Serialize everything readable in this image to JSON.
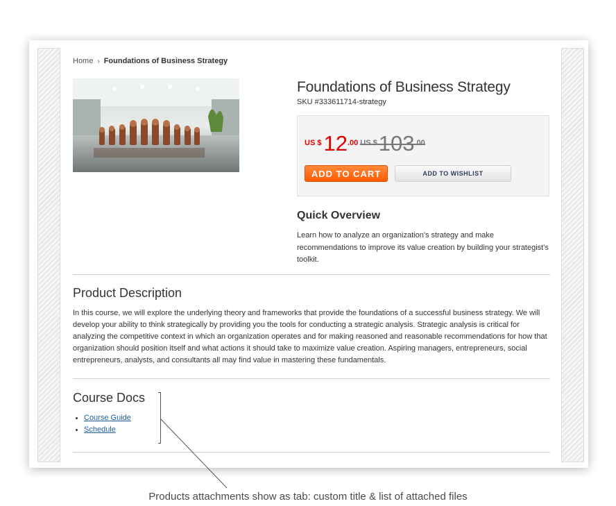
{
  "breadcrumb": {
    "home": "Home",
    "separator": "›",
    "current": "Foundations of Business Strategy"
  },
  "product": {
    "title": "Foundations of Business Strategy",
    "sku": "SKU #333611714-strategy",
    "image_icon": "chess-pieces-image"
  },
  "price": {
    "currency": "US $",
    "new_main": "12",
    "new_cents": ".00",
    "old_currency": "US $",
    "old_main": "103",
    "old_cents": ".00"
  },
  "buttons": {
    "add_to_cart": "ADD TO CART",
    "add_to_wishlist": "ADD TO WISHLIST"
  },
  "overview": {
    "heading": "Quick Overview",
    "text": "Learn how to analyze an organization's strategy and make recommendations to improve its value creation by building your strategist's toolkit."
  },
  "description": {
    "heading": "Product Description",
    "text": "In this course, we will explore the underlying theory and frameworks that provide the foundations of a successful business strategy. We will develop your ability to think strategically by providing you the tools for conducting a strategic analysis. Strategic analysis is critical for analyzing the competitive context in which an organization operates and for making reasoned and reasonable recommendations for how that organization should position itself and what actions it should take to maximize value creation. Aspiring managers, entrepreneurs, social entrepreneurs, analysts, and consultants all may find value in mastering these fundamentals."
  },
  "docs": {
    "heading": "Course Docs",
    "items": [
      {
        "label": "Course Guide"
      },
      {
        "label": "Schedule"
      }
    ]
  },
  "caption": "Products attachments show as tab: custom title & list of attached files",
  "colors": {
    "price_red": "#e00000",
    "cart_orange": "#ff6a10",
    "link_blue": "#1a5ea8"
  }
}
